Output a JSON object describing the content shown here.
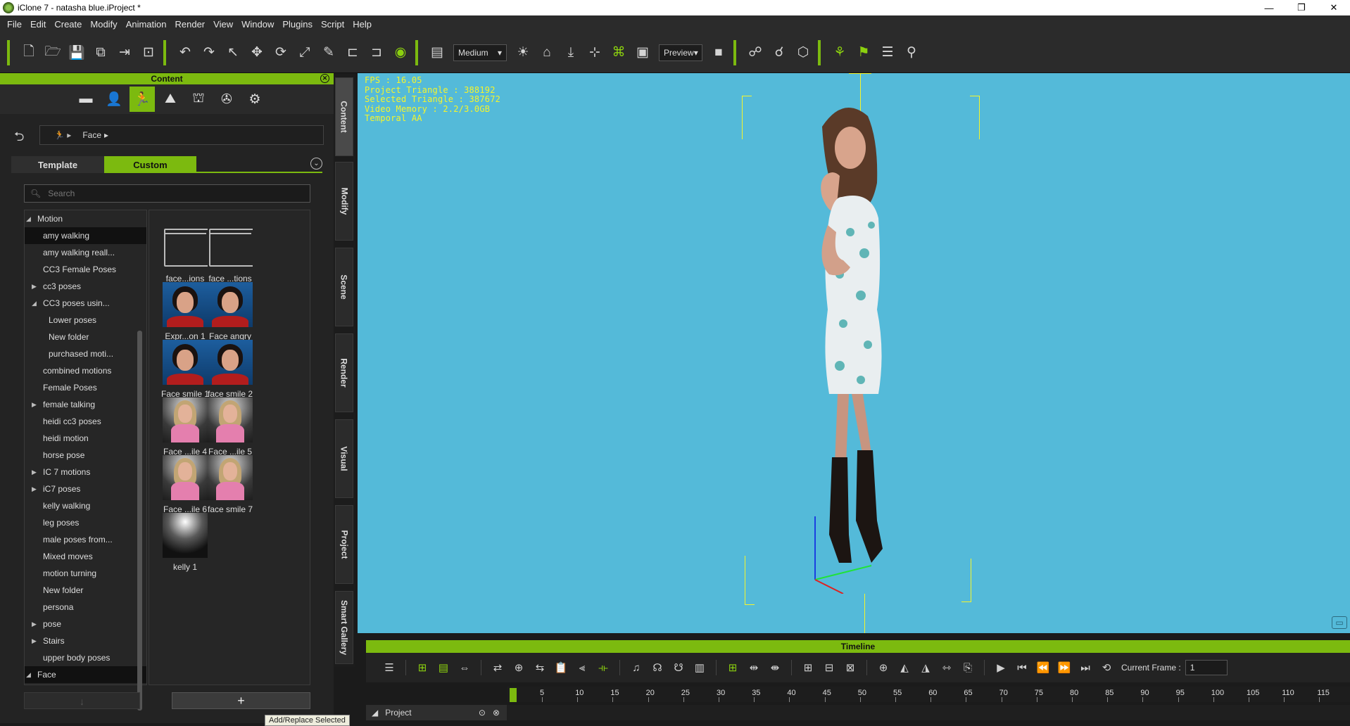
{
  "window": {
    "title": "iClone 7 - natasha blue.iProject *",
    "controls": [
      "—",
      "❐",
      "✕"
    ]
  },
  "menu": [
    "File",
    "Edit",
    "Create",
    "Modify",
    "Animation",
    "Render",
    "View",
    "Window",
    "Plugins",
    "Script",
    "Help"
  ],
  "toolbar": {
    "quality": "Medium",
    "render_mode": "Preview"
  },
  "content": {
    "header": "Content",
    "path_label": "Face",
    "tabs": {
      "template": "Template",
      "custom": "Custom"
    },
    "search_placeholder": "Search",
    "tree": [
      {
        "label": "Motion",
        "level": 0,
        "expanded": true
      },
      {
        "label": "amy walking",
        "level": 1,
        "selected": true
      },
      {
        "label": "amy walking reall...",
        "level": 1
      },
      {
        "label": "CC3 Female Poses",
        "level": 1
      },
      {
        "label": "cc3 poses",
        "level": 1,
        "collapsed": true
      },
      {
        "label": "CC3 poses usin...",
        "level": 1,
        "expanded": true
      },
      {
        "label": "Lower poses",
        "level": 2
      },
      {
        "label": "New folder",
        "level": 2
      },
      {
        "label": "purchased moti...",
        "level": 2
      },
      {
        "label": "combined motions",
        "level": 1
      },
      {
        "label": "Female Poses",
        "level": 1
      },
      {
        "label": "female talking",
        "level": 1,
        "collapsed": true
      },
      {
        "label": "heidi cc3 poses",
        "level": 1
      },
      {
        "label": "heidi motion",
        "level": 1
      },
      {
        "label": "horse pose",
        "level": 1
      },
      {
        "label": "IC 7 motions",
        "level": 1,
        "collapsed": true
      },
      {
        "label": "iC7 poses",
        "level": 1,
        "collapsed": true
      },
      {
        "label": "kelly walking",
        "level": 1
      },
      {
        "label": "leg poses",
        "level": 1
      },
      {
        "label": "male poses from...",
        "level": 1
      },
      {
        "label": "Mixed moves",
        "level": 1
      },
      {
        "label": "motion turning",
        "level": 1
      },
      {
        "label": "New folder",
        "level": 1
      },
      {
        "label": "persona",
        "level": 1
      },
      {
        "label": "pose",
        "level": 1,
        "collapsed": true
      },
      {
        "label": "Stairs",
        "level": 1,
        "collapsed": true
      },
      {
        "label": "upper body poses",
        "level": 1
      },
      {
        "label": "Face",
        "level": 0,
        "expanded": true,
        "selected": true
      }
    ],
    "items": [
      {
        "label": "face...ions",
        "kind": "folder"
      },
      {
        "label": "face ...tions",
        "kind": "folder"
      },
      {
        "label": "Expr...on 1",
        "kind": "face"
      },
      {
        "label": "Face angry",
        "kind": "face"
      },
      {
        "label": "Face smile 1",
        "kind": "face"
      },
      {
        "label": "face smile 2",
        "kind": "face"
      },
      {
        "label": "Face ...ile 4",
        "kind": "blonde"
      },
      {
        "label": "Face ...ile 5",
        "kind": "blonde"
      },
      {
        "label": "Face ...ile 6",
        "kind": "blonde"
      },
      {
        "label": "face smile 7",
        "kind": "blonde"
      },
      {
        "label": "kelly 1",
        "kind": "dark"
      }
    ],
    "add_button": "+",
    "tooltip": "Add/Replace Selected"
  },
  "side_tabs": [
    "Content",
    "Modify",
    "Scene",
    "Render",
    "Visual",
    "Project",
    "Smart Gallery"
  ],
  "viewport": {
    "stats": [
      "FPS : 16.05",
      "Project Triangle : 388192",
      "Selected Triangle : 387672",
      "Video Memory : 2.2/3.0GB",
      "Temporal AA"
    ],
    "background_color": "#54bad9"
  },
  "timeline": {
    "header": "Timeline",
    "current_frame_label": "Current Frame :",
    "current_frame_value": "1",
    "ruler": [
      "5",
      "10",
      "15",
      "20",
      "25",
      "30",
      "35",
      "40",
      "45",
      "50",
      "55",
      "60",
      "65",
      "70",
      "75",
      "80",
      "85",
      "90",
      "95",
      "100",
      "105",
      "110",
      "115"
    ],
    "track": "Project"
  },
  "colors": {
    "accent": "#7cba0f",
    "viewport": "#54bad9",
    "stats_text": "#f5f52b"
  }
}
